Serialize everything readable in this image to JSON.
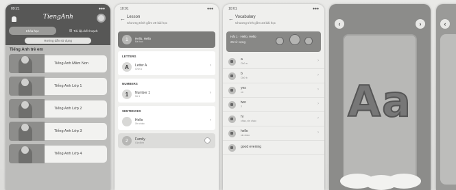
{
  "screen1": {
    "time": "09:21",
    "logo": "TiengAnh",
    "tabs": [
      {
        "label": "Khóa học"
      },
      {
        "label": "Tài liệu kết hoạch"
      }
    ],
    "guide": "Hướng dẫn sử dụng",
    "section_title": "Tiếng Anh trẻ em",
    "courses": [
      {
        "label": "Tiếng Anh Mầm Non"
      },
      {
        "label": "Tiếng Anh Lớp 1"
      },
      {
        "label": "Tiếng Anh Lớp 2"
      },
      {
        "label": "Tiếng Anh Lớp 3"
      },
      {
        "label": "Tiếng Anh Lớp 4"
      }
    ]
  },
  "screen2": {
    "time": "10:01",
    "title": "Lesson",
    "subtitle": "Chương trình gồm 29 bài học",
    "selected_number": "1",
    "selected_label": "Hello, Hello",
    "selected_sub": "Bài học",
    "groups": [
      {
        "caption": "LETTERS",
        "items": [
          {
            "icon": "A",
            "title": "Letter A",
            "sub": "Chữ A"
          }
        ]
      },
      {
        "caption": "NUMBERS",
        "items": [
          {
            "icon": "1",
            "title": "Number 1",
            "sub": "Số 1"
          }
        ]
      },
      {
        "caption": "SENTENCES",
        "items": [
          {
            "icon": "",
            "title": "Hello",
            "sub": "Xin chào"
          }
        ]
      }
    ],
    "family_number": "2",
    "family_title": "Family",
    "family_sub": "Gia đình"
  },
  "screen3": {
    "time": "10:01",
    "title": "Vocabulary",
    "subtitle": "Chương trình gồm 24 bài học",
    "banner_line1": "Hải 1 · Hello, Hello",
    "banner_line2": "25 từ vựng",
    "words": [
      {
        "word": "a",
        "meaning": "Chữ a"
      },
      {
        "word": "b",
        "meaning": "Chữ b"
      },
      {
        "word": "yes",
        "meaning": "có"
      },
      {
        "word": "two",
        "meaning": "2"
      },
      {
        "word": "hi",
        "meaning": "chào, xin chào"
      },
      {
        "word": "hello",
        "meaning": "xin chào"
      },
      {
        "word": "good evening",
        "meaning": ""
      }
    ]
  },
  "screen4": {
    "flashcard_letter": "Aa"
  },
  "colors": {
    "background": "#e2e2e0",
    "accent": "#7b7b79"
  },
  "icons": [
    "bell-icon",
    "back-arrow-icon",
    "chevron-right-icon",
    "speaker-icon",
    "lock-icon",
    "chevron-left-icon"
  ]
}
